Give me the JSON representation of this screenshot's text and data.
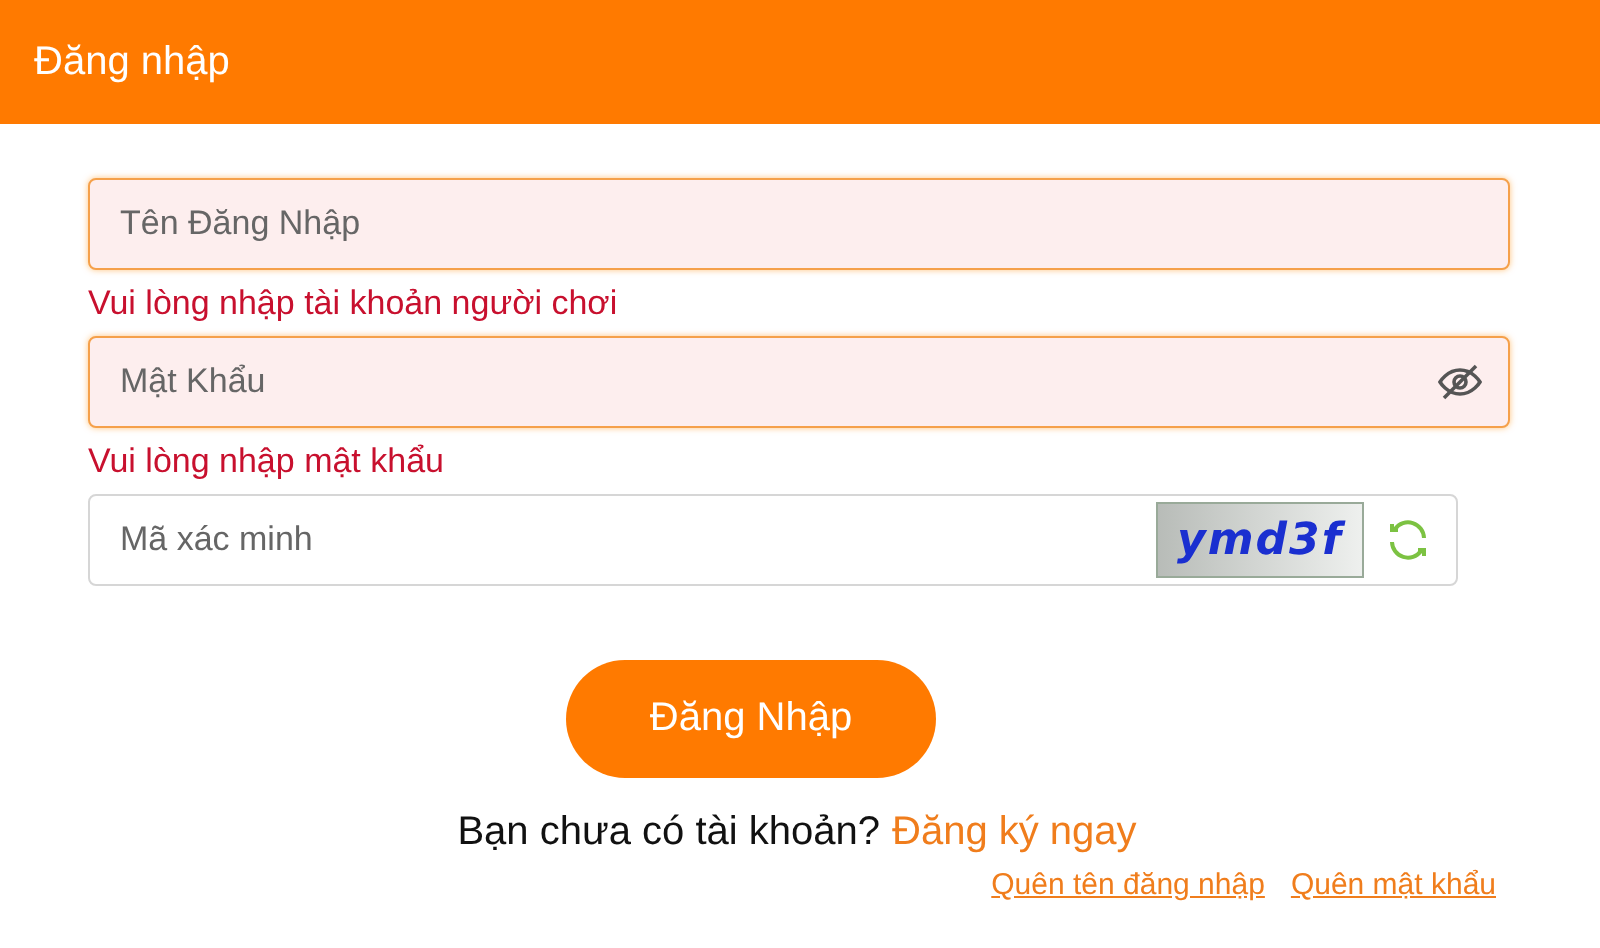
{
  "header": {
    "title": "Đăng nhập"
  },
  "fields": [
    {
      "kind": "text",
      "placeholder": "Tên Đăng Nhập",
      "invalid": true,
      "error": "Vui lòng nhập tài khoản người chơi"
    },
    {
      "kind": "password",
      "placeholder": "Mật Khẩu",
      "invalid": true,
      "error": "Vui lòng nhập mật khẩu"
    },
    {
      "kind": "captcha",
      "placeholder": "Mã xác minh",
      "invalid": false,
      "captcha": "ymd3f"
    }
  ],
  "submit": {
    "label": "Đăng Nhập"
  },
  "signup": {
    "prompt": "Bạn chưa có tài khoản?",
    "link": "Đăng ký ngay"
  },
  "links": [
    "Quên tên đăng nhập",
    "Quên mật khẩu"
  ]
}
